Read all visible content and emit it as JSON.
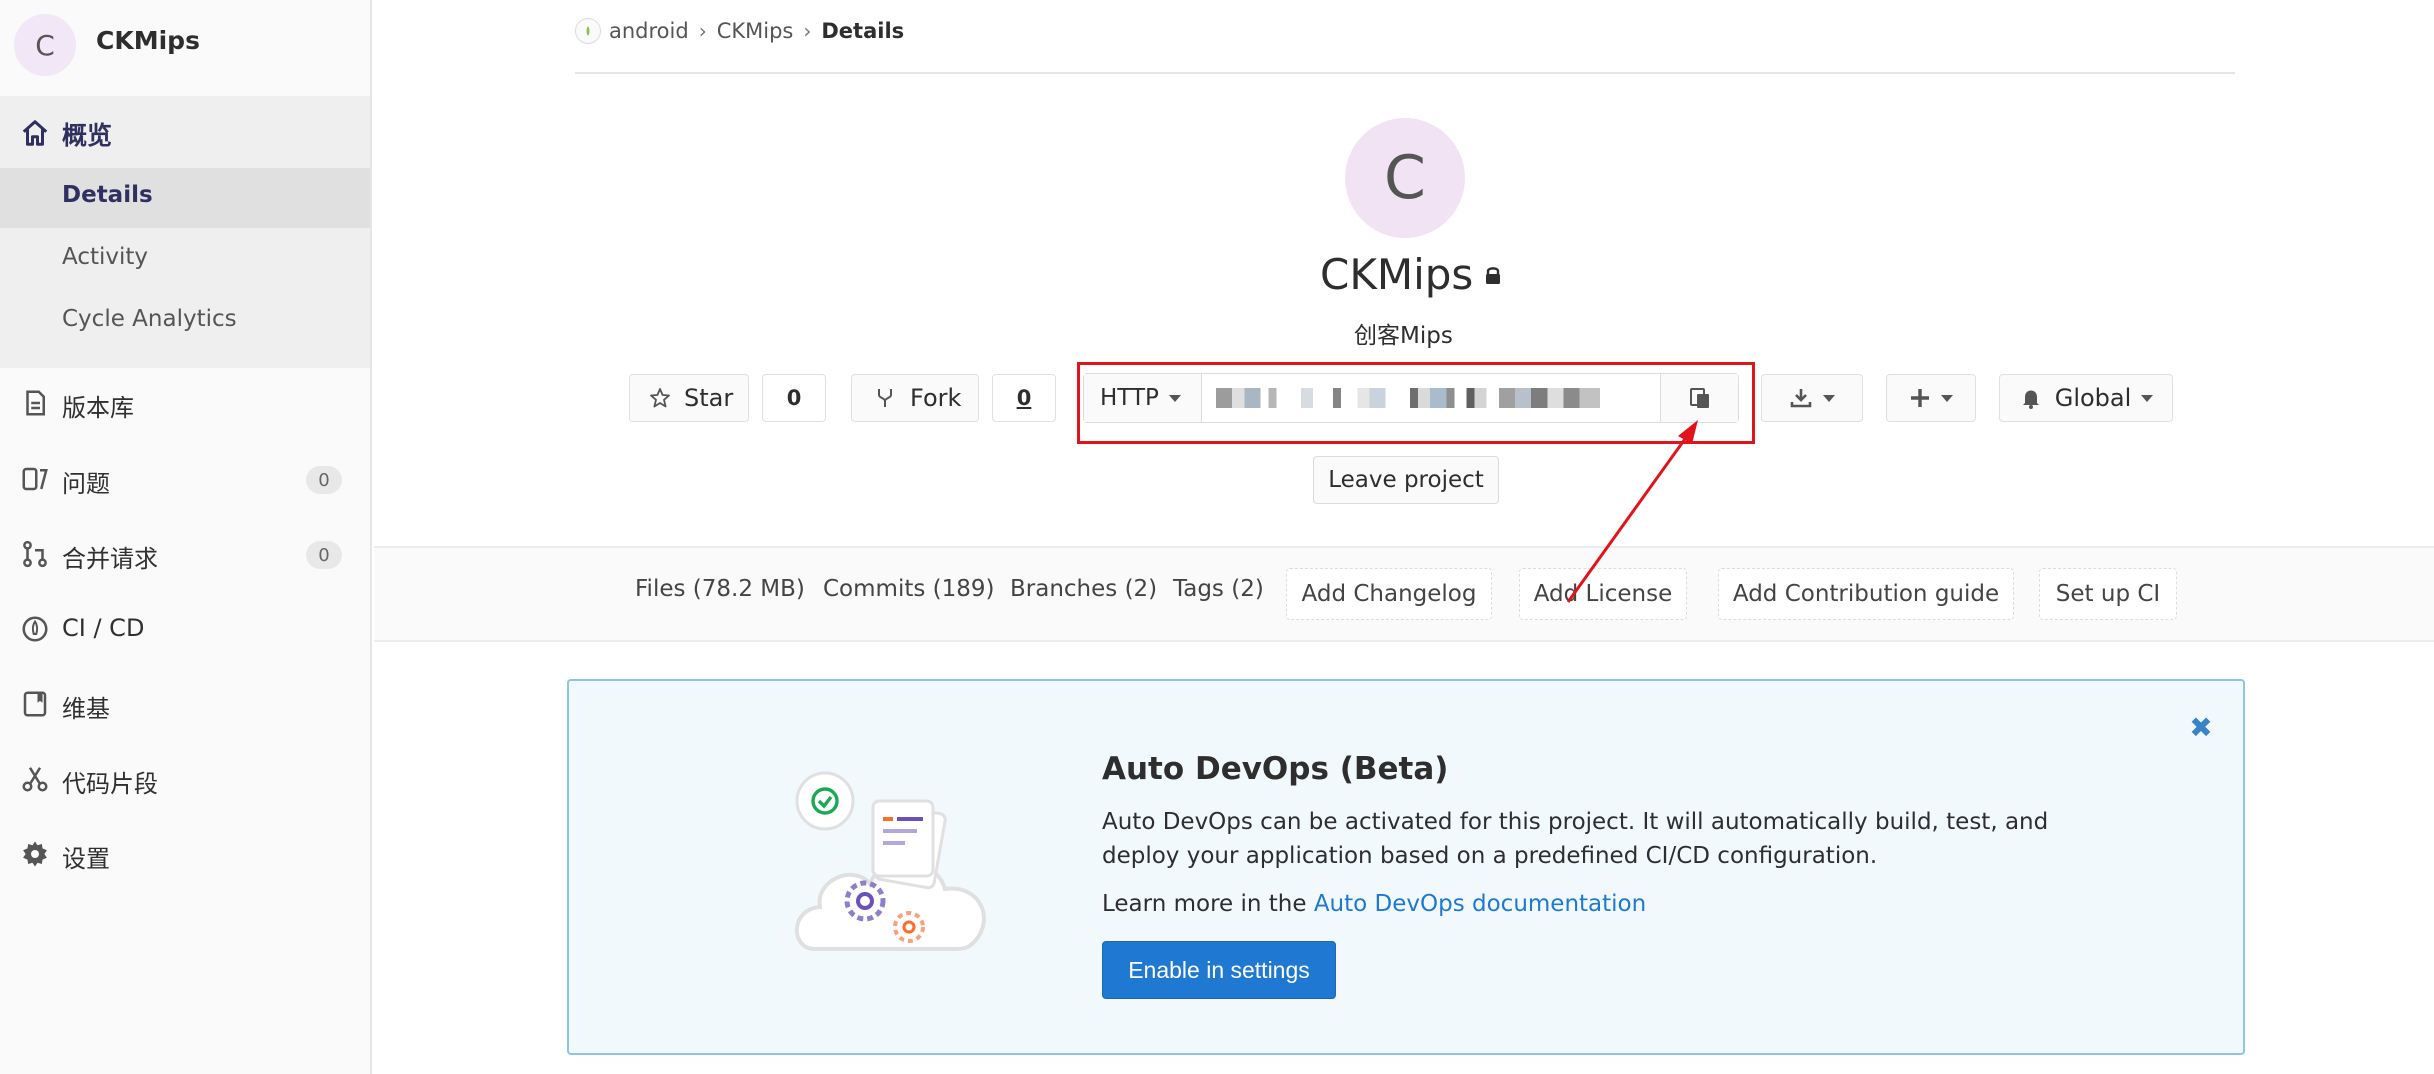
{
  "sidebar": {
    "avatar_letter": "C",
    "project_name": "CKMips",
    "overview_label": "概览",
    "sub_items": [
      {
        "label": "Details"
      },
      {
        "label": "Activity"
      },
      {
        "label": "Cycle Analytics"
      }
    ],
    "items": [
      {
        "label": "版本库",
        "icon": "repository-icon"
      },
      {
        "label": "问题",
        "icon": "issues-icon",
        "badge": "0"
      },
      {
        "label": "合并请求",
        "icon": "merge-request-icon",
        "badge": "0"
      },
      {
        "label": "CI / CD",
        "icon": "rocket-icon"
      },
      {
        "label": "维基",
        "icon": "book-icon"
      },
      {
        "label": "代码片段",
        "icon": "scissors-icon"
      },
      {
        "label": "设置",
        "icon": "gear-icon"
      }
    ]
  },
  "breadcrumb": {
    "group": "android",
    "project": "CKMips",
    "current": "Details"
  },
  "project": {
    "avatar_letter": "C",
    "name": "CKMips",
    "description": "创客Mips"
  },
  "actions": {
    "star_label": "Star",
    "star_count": "0",
    "fork_label": "Fork",
    "fork_count": "0",
    "clone_protocol": "HTTP",
    "notification_label": "Global",
    "leave_label": "Leave project"
  },
  "stats": {
    "files": "Files (78.2 MB)",
    "commits": "Commits (189)",
    "branches": "Branches (2)",
    "tags": "Tags (2)",
    "add_changelog": "Add Changelog",
    "add_license": "Add License",
    "add_contribution": "Add Contribution guide",
    "setup_ci": "Set up CI"
  },
  "devops": {
    "title": "Auto DevOps (Beta)",
    "text": "Auto DevOps can be activated for this project. It will automatically build, test, and deploy your application based on a predefined CI/CD configuration.",
    "learn_prefix": "Learn more in the",
    "learn_link": "Auto DevOps documentation",
    "enable_label": "Enable in settings",
    "close_glyph": "✖"
  },
  "colors": {
    "primary": "#1f78d1",
    "annotation": "#e3131b",
    "sidebar_active_text": "#303060"
  }
}
